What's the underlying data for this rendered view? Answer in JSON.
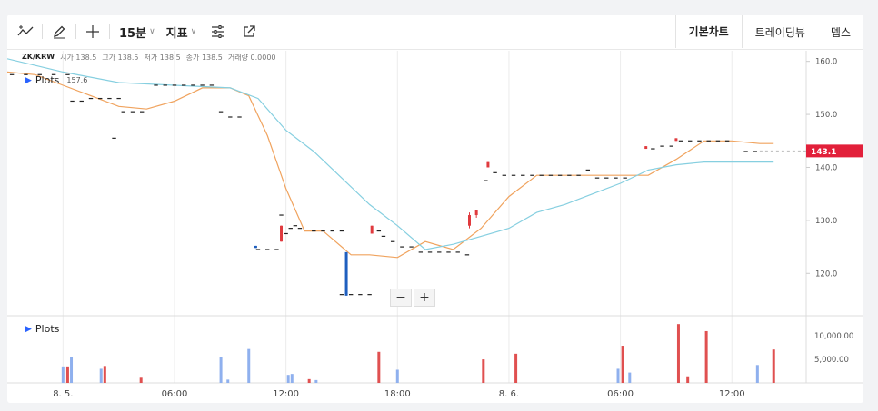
{
  "toolbar": {
    "interval": "15분",
    "indicator": "지표",
    "tabs": [
      "기본차트",
      "트레이딩뷰",
      "뎁스"
    ]
  },
  "legend": {
    "symbol": "ZK/KRW",
    "open_label": "시가",
    "open": "138.5",
    "high_label": "고가",
    "high": "138.5",
    "low_label": "저가",
    "low": "138.5",
    "close_label": "종가",
    "close": "138.5",
    "volume_label": "거래량",
    "volume": "0.0000"
  },
  "plots_label": "Plots",
  "plot_marker": "157.6",
  "current_price": "143.1",
  "colors": {
    "up": "#e03a3e",
    "down": "#1f5fbf",
    "vol_up": "#e05050",
    "vol_down": "#8fb0ee",
    "ma_short": "#f0a35e",
    "ma_long": "#86cfe0"
  },
  "chart_data": {
    "type": "line",
    "price_axis": {
      "ticks": [
        160,
        150,
        140,
        130,
        120
      ],
      "tick_labels": [
        "160.0",
        "150.0",
        "140.0",
        "130.0",
        "120.0"
      ],
      "ylim": [
        112,
        162
      ]
    },
    "volume_axis": {
      "ticks": [
        10000,
        5000
      ],
      "tick_labels": [
        "10,000.00",
        "5,000.00"
      ],
      "ylim": [
        0,
        13500
      ]
    },
    "x_tick_labels": [
      "8. 5.",
      "06:00",
      "12:00",
      "18:00",
      "8. 6.",
      "06:00",
      "12:00"
    ],
    "x_tick_positions": [
      0,
      24,
      48,
      72,
      96,
      120,
      144
    ],
    "xlim": [
      -12,
      160
    ],
    "series": [
      {
        "x": [
          -12,
          -6,
          0,
          6,
          12,
          18,
          24,
          30,
          36,
          40,
          44,
          48,
          52,
          56,
          62,
          66,
          72,
          78,
          84,
          90,
          96,
          102,
          108,
          114,
          120,
          126,
          132,
          138,
          144,
          150,
          153
        ],
        "values": [
          158,
          157.5,
          155.5,
          153.5,
          151.5,
          151,
          152.5,
          155,
          155,
          153.5,
          146,
          136,
          128,
          128,
          123.5,
          123.5,
          123,
          126,
          124.5,
          128.5,
          134.5,
          138.5,
          138.5,
          138.5,
          138.5,
          138.5,
          141.5,
          145,
          145,
          144.5,
          144.5
        ]
      },
      {
        "x": [
          -12,
          0,
          12,
          24,
          36,
          42,
          48,
          54,
          60,
          66,
          72,
          78,
          84,
          90,
          96,
          102,
          108,
          114,
          120,
          126,
          132,
          138,
          144,
          150,
          153
        ],
        "values": [
          160.5,
          158,
          156,
          155.5,
          155,
          153,
          147,
          143,
          138,
          133,
          129,
          124.5,
          125.5,
          127,
          128.5,
          131.5,
          133,
          135,
          137,
          139.5,
          140.5,
          141,
          141,
          141,
          141
        ]
      }
    ],
    "ticks": [
      {
        "x": -11,
        "y": 157.5
      },
      {
        "x": -8,
        "y": 157.5
      },
      {
        "x": -5,
        "y": 157.5
      },
      {
        "x": -2,
        "y": 157.5
      },
      {
        "x": 1,
        "y": 157.5
      },
      {
        "x": 2,
        "y": 152.5
      },
      {
        "x": 4,
        "y": 152.5
      },
      {
        "x": 6,
        "y": 153
      },
      {
        "x": 8,
        "y": 153
      },
      {
        "x": 10,
        "y": 153
      },
      {
        "x": 12,
        "y": 153
      },
      {
        "x": 11,
        "y": 145.5
      },
      {
        "x": 13,
        "y": 150.5
      },
      {
        "x": 15,
        "y": 150.5
      },
      {
        "x": 17,
        "y": 150.5
      },
      {
        "x": 20,
        "y": 155.5
      },
      {
        "x": 22,
        "y": 155.5
      },
      {
        "x": 24,
        "y": 155.5
      },
      {
        "x": 26,
        "y": 155.5
      },
      {
        "x": 28,
        "y": 155.5
      },
      {
        "x": 30,
        "y": 155.5
      },
      {
        "x": 32,
        "y": 155.5
      },
      {
        "x": 34,
        "y": 150.5
      },
      {
        "x": 36,
        "y": 149.5
      },
      {
        "x": 38,
        "y": 149.5
      },
      {
        "x": 42,
        "y": 124.5
      },
      {
        "x": 44,
        "y": 124.5
      },
      {
        "x": 46,
        "y": 124.5
      },
      {
        "x": 47,
        "y": 131
      },
      {
        "x": 48,
        "y": 127.5
      },
      {
        "x": 49,
        "y": 128.5
      },
      {
        "x": 50,
        "y": 129
      },
      {
        "x": 51,
        "y": 128.5
      },
      {
        "x": 54,
        "y": 128
      },
      {
        "x": 56,
        "y": 128
      },
      {
        "x": 58,
        "y": 128
      },
      {
        "x": 60,
        "y": 128
      },
      {
        "x": 60,
        "y": 116
      },
      {
        "x": 62,
        "y": 116
      },
      {
        "x": 64,
        "y": 116
      },
      {
        "x": 66,
        "y": 116
      },
      {
        "x": 68,
        "y": 128
      },
      {
        "x": 69,
        "y": 127
      },
      {
        "x": 71,
        "y": 126
      },
      {
        "x": 73,
        "y": 125
      },
      {
        "x": 75,
        "y": 125
      },
      {
        "x": 77,
        "y": 124
      },
      {
        "x": 79,
        "y": 124
      },
      {
        "x": 81,
        "y": 124
      },
      {
        "x": 83,
        "y": 124
      },
      {
        "x": 85,
        "y": 124
      },
      {
        "x": 87,
        "y": 123.5
      },
      {
        "x": 91,
        "y": 137.5
      },
      {
        "x": 93,
        "y": 139
      },
      {
        "x": 95,
        "y": 138.5
      },
      {
        "x": 97,
        "y": 138.5
      },
      {
        "x": 99,
        "y": 138.5
      },
      {
        "x": 101,
        "y": 138.5
      },
      {
        "x": 103,
        "y": 138.5
      },
      {
        "x": 105,
        "y": 138.5
      },
      {
        "x": 107,
        "y": 138.5
      },
      {
        "x": 109,
        "y": 138.5
      },
      {
        "x": 111,
        "y": 138.5
      },
      {
        "x": 113,
        "y": 139.5
      },
      {
        "x": 115,
        "y": 138
      },
      {
        "x": 117,
        "y": 138
      },
      {
        "x": 119,
        "y": 138
      },
      {
        "x": 121,
        "y": 138
      },
      {
        "x": 127,
        "y": 143.5
      },
      {
        "x": 129,
        "y": 144
      },
      {
        "x": 131,
        "y": 144
      },
      {
        "x": 133,
        "y": 145
      },
      {
        "x": 135,
        "y": 145
      },
      {
        "x": 137,
        "y": 145
      },
      {
        "x": 139,
        "y": 145
      },
      {
        "x": 141,
        "y": 145
      },
      {
        "x": 143,
        "y": 145
      },
      {
        "x": 147,
        "y": 143
      },
      {
        "x": 149,
        "y": 143
      }
    ],
    "candles": [
      {
        "x": 47,
        "open": 129,
        "close": 126,
        "high": 129,
        "low": 126,
        "dir": "up"
      },
      {
        "x": 66.5,
        "open": 129,
        "close": 127.5,
        "high": 129,
        "low": 127.5,
        "dir": "up"
      },
      {
        "x": 87.5,
        "open": 129,
        "close": 131,
        "high": 131.5,
        "low": 128.5,
        "dir": "up"
      },
      {
        "x": 89,
        "open": 131,
        "close": 132,
        "high": 132,
        "low": 130.5,
        "dir": "up"
      },
      {
        "x": 91.5,
        "open": 140,
        "close": 141,
        "high": 141,
        "low": 140,
        "dir": "up"
      },
      {
        "x": 125.5,
        "open": 143.5,
        "close": 144,
        "high": 144,
        "low": 143.5,
        "dir": "up"
      },
      {
        "x": 132,
        "open": 145,
        "close": 145.5,
        "high": 145.5,
        "low": 145,
        "dir": "up"
      },
      {
        "x": 41.5,
        "open": 125.2,
        "close": 124.8,
        "high": 125.2,
        "low": 124.8,
        "dir": "down"
      },
      {
        "x": 61,
        "open": 124,
        "close": 115.8,
        "high": 124,
        "low": 115.8,
        "dir": "down"
      }
    ],
    "volume": [
      {
        "x": 0,
        "v": 3500,
        "dir": "down"
      },
      {
        "x": 1,
        "v": 3500,
        "dir": "up"
      },
      {
        "x": 1.8,
        "v": 5400,
        "dir": "down"
      },
      {
        "x": 8.2,
        "v": 3000,
        "dir": "down"
      },
      {
        "x": 9,
        "v": 3600,
        "dir": "up"
      },
      {
        "x": 16.8,
        "v": 1100,
        "dir": "up"
      },
      {
        "x": 34,
        "v": 5500,
        "dir": "down"
      },
      {
        "x": 35.5,
        "v": 700,
        "dir": "down"
      },
      {
        "x": 40,
        "v": 7200,
        "dir": "down"
      },
      {
        "x": 48.5,
        "v": 1700,
        "dir": "down"
      },
      {
        "x": 49.3,
        "v": 1900,
        "dir": "down"
      },
      {
        "x": 53,
        "v": 800,
        "dir": "up"
      },
      {
        "x": 54.5,
        "v": 600,
        "dir": "down"
      },
      {
        "x": 68,
        "v": 6600,
        "dir": "up"
      },
      {
        "x": 72,
        "v": 2800,
        "dir": "down"
      },
      {
        "x": 90.5,
        "v": 5000,
        "dir": "up"
      },
      {
        "x": 97.5,
        "v": 6200,
        "dir": "up"
      },
      {
        "x": 119.5,
        "v": 3000,
        "dir": "down"
      },
      {
        "x": 120.5,
        "v": 7900,
        "dir": "up"
      },
      {
        "x": 122,
        "v": 2200,
        "dir": "down"
      },
      {
        "x": 132.5,
        "v": 12500,
        "dir": "up"
      },
      {
        "x": 134.5,
        "v": 1400,
        "dir": "up"
      },
      {
        "x": 138.5,
        "v": 11000,
        "dir": "up"
      },
      {
        "x": 149.5,
        "v": 3800,
        "dir": "down"
      },
      {
        "x": 153,
        "v": 7100,
        "dir": "up"
      }
    ]
  }
}
